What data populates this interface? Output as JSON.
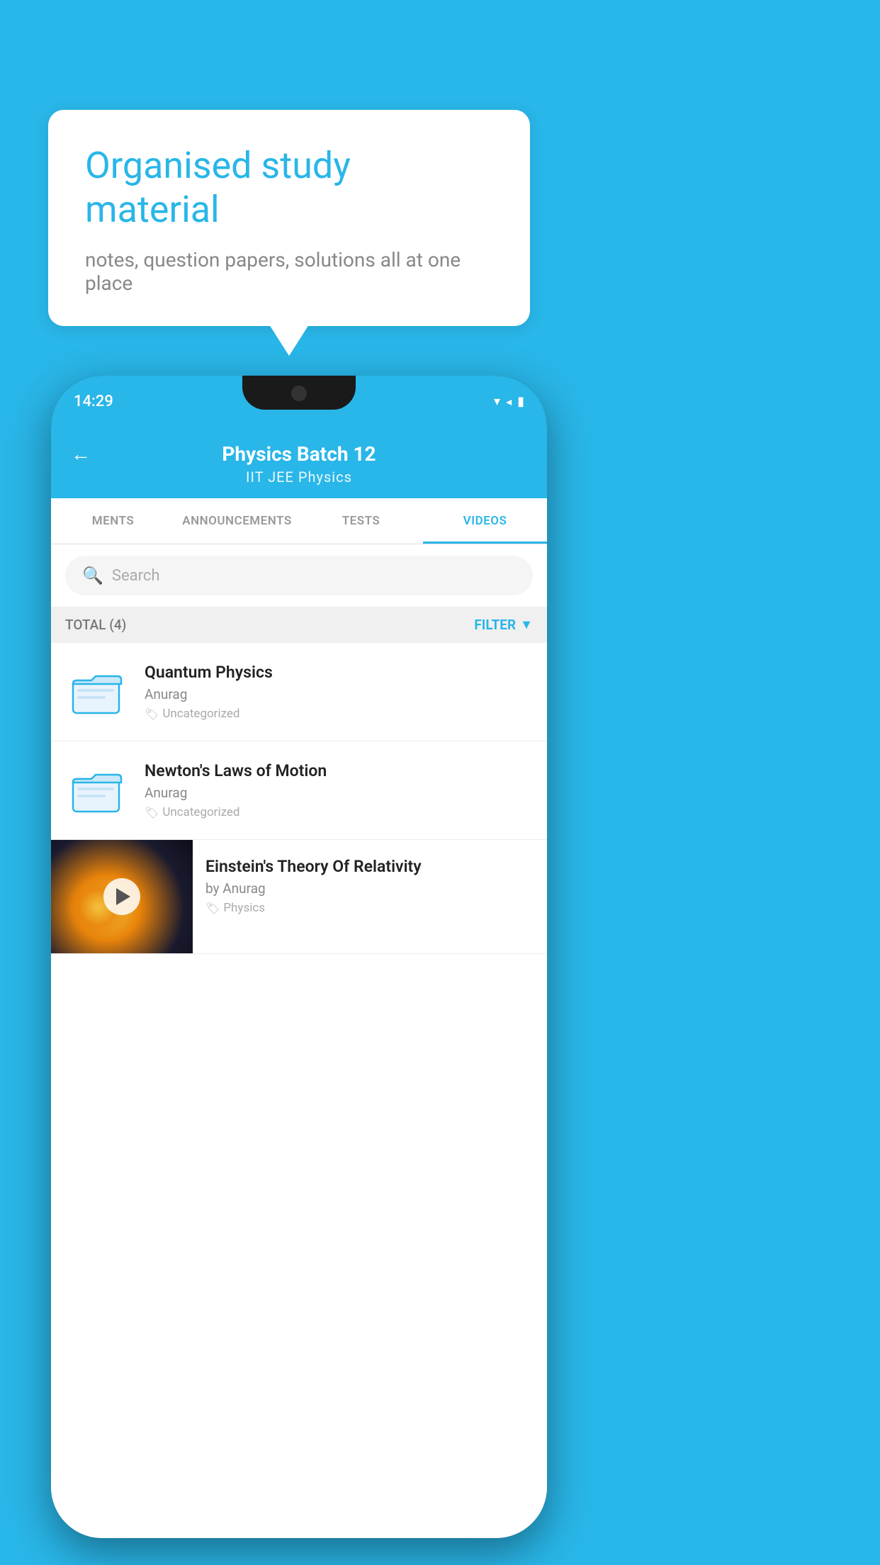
{
  "background_color": "#29b6e8",
  "speech_bubble": {
    "title": "Organised study material",
    "subtitle": "notes, question papers, solutions all at one place"
  },
  "status_bar": {
    "time": "14:29",
    "wifi": "▾",
    "signal": "◂",
    "battery": "▮"
  },
  "header": {
    "back_label": "←",
    "title": "Physics Batch 12",
    "subtitle": "IIT JEE   Physics"
  },
  "tabs": [
    {
      "label": "MENTS",
      "active": false
    },
    {
      "label": "ANNOUNCEMENTS",
      "active": false
    },
    {
      "label": "TESTS",
      "active": false
    },
    {
      "label": "VIDEOS",
      "active": true
    }
  ],
  "search": {
    "placeholder": "Search"
  },
  "filter_bar": {
    "total_label": "TOTAL (4)",
    "filter_label": "FILTER"
  },
  "videos": [
    {
      "id": 1,
      "title": "Quantum Physics",
      "author": "Anurag",
      "tag": "Uncategorized",
      "has_thumbnail": false
    },
    {
      "id": 2,
      "title": "Newton's Laws of Motion",
      "author": "Anurag",
      "tag": "Uncategorized",
      "has_thumbnail": false
    },
    {
      "id": 3,
      "title": "Einstein's Theory Of Relativity",
      "author": "by Anurag",
      "tag": "Physics",
      "has_thumbnail": true
    }
  ],
  "icons": {
    "search": "🔍",
    "tag": "🏷",
    "filter": "▼",
    "play": "▶"
  }
}
